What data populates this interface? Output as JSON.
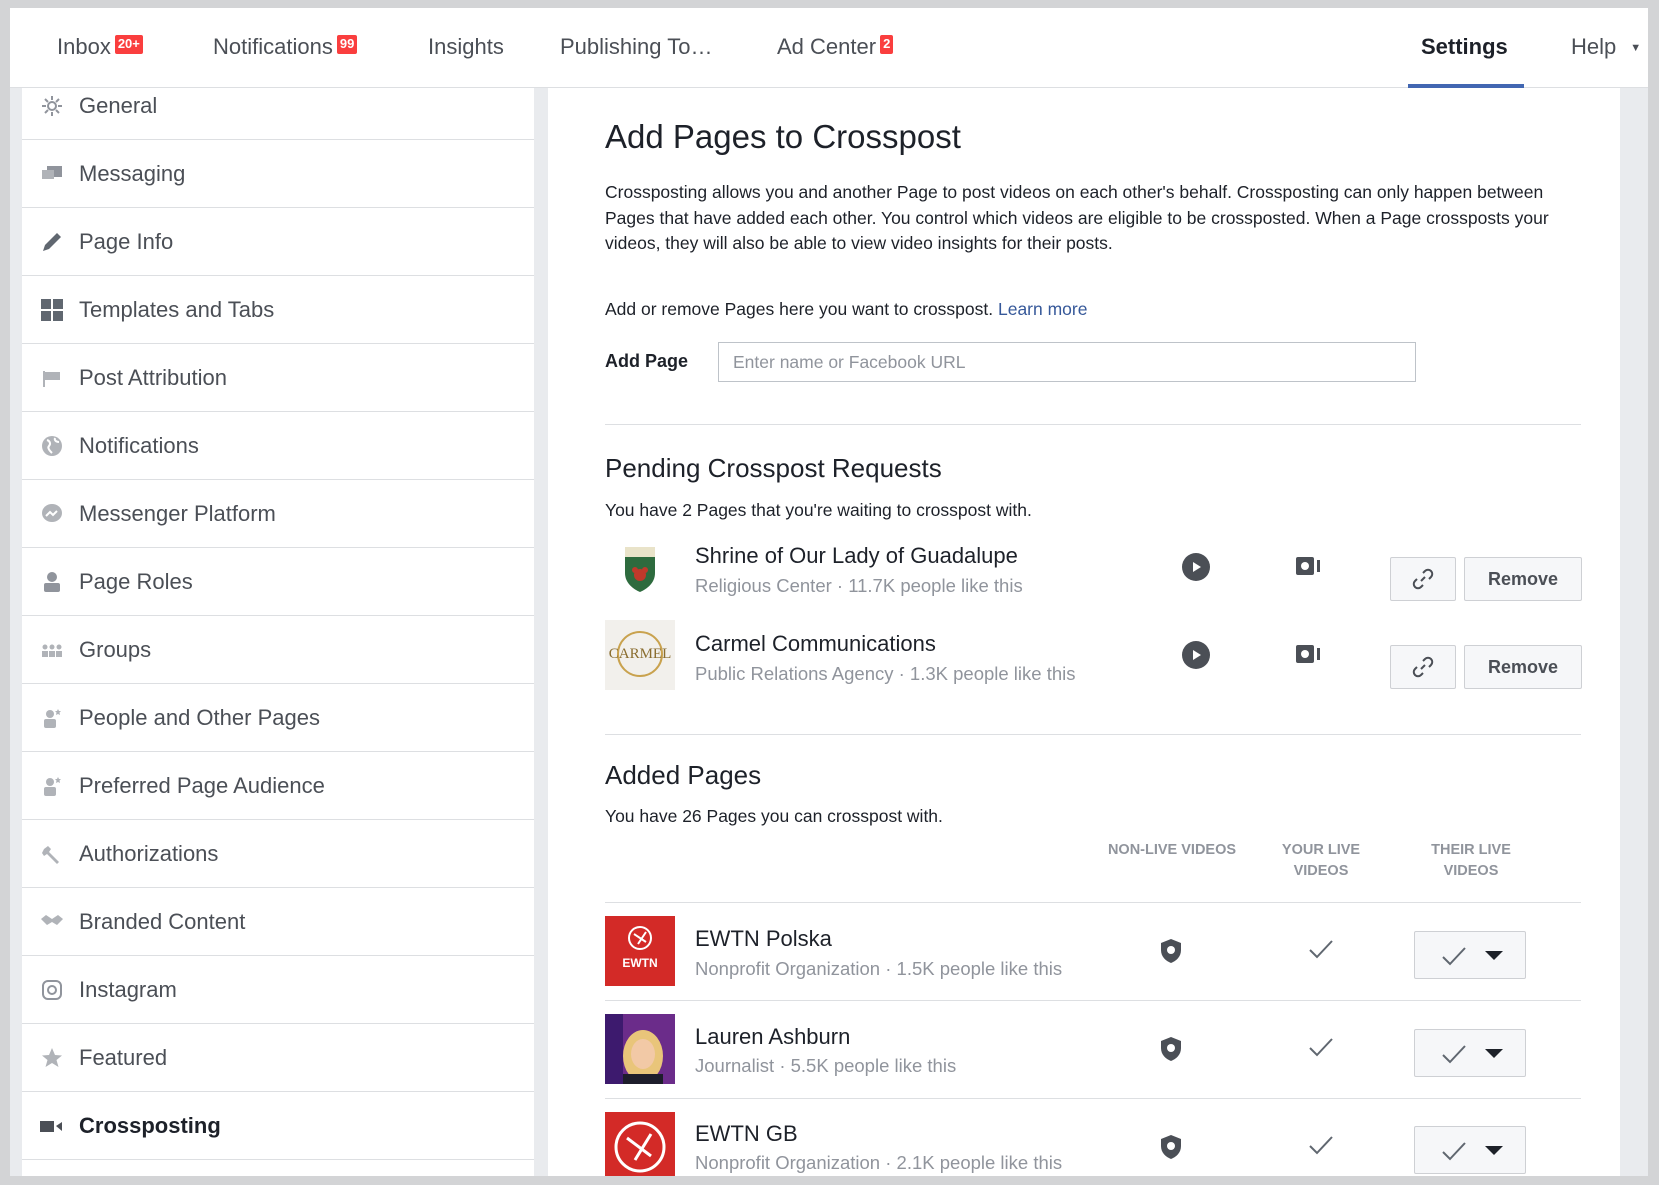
{
  "topnav": {
    "inbox": {
      "label": "Inbox",
      "badge": "20+"
    },
    "notifications": {
      "label": "Notifications",
      "badge": "99"
    },
    "insights": {
      "label": "Insights"
    },
    "publishing": {
      "label": "Publishing To…"
    },
    "adcenter": {
      "label": "Ad Center",
      "badge": "2"
    },
    "settings": {
      "label": "Settings"
    },
    "help": {
      "label": "Help"
    }
  },
  "sidebar": {
    "items": [
      {
        "label": "General",
        "icon": "gear-icon"
      },
      {
        "label": "Messaging",
        "icon": "chat-icon"
      },
      {
        "label": "Page Info",
        "icon": "pencil-icon"
      },
      {
        "label": "Templates and Tabs",
        "icon": "grid-icon"
      },
      {
        "label": "Post Attribution",
        "icon": "flag-icon"
      },
      {
        "label": "Notifications",
        "icon": "globe-icon"
      },
      {
        "label": "Messenger Platform",
        "icon": "messenger-icon"
      },
      {
        "label": "Page Roles",
        "icon": "person-icon"
      },
      {
        "label": "Groups",
        "icon": "groups-icon"
      },
      {
        "label": "People and Other Pages",
        "icon": "person-star-icon"
      },
      {
        "label": "Preferred Page Audience",
        "icon": "person-star-icon"
      },
      {
        "label": "Authorizations",
        "icon": "wrench-icon"
      },
      {
        "label": "Branded Content",
        "icon": "handshake-icon"
      },
      {
        "label": "Instagram",
        "icon": "instagram-icon"
      },
      {
        "label": "Featured",
        "icon": "star-icon"
      },
      {
        "label": "Crossposting",
        "icon": "video-camera-icon"
      }
    ],
    "active": "Crossposting"
  },
  "main": {
    "title": "Add Pages to Crosspost",
    "description": "Crossposting allows you and another Page to post videos on each other's behalf. Crossposting can only happen between Pages that have added each other. You control which videos are eligible to be crossposted. When a Page crossposts your videos, they will also be able to view video insights for their posts.",
    "addremove_text": "Add or remove Pages here you want to crosspost. ",
    "learn_more": "Learn more",
    "add_page_label": "Add Page",
    "add_page_placeholder": "Enter name or Facebook URL",
    "pending": {
      "title": "Pending Crosspost Requests",
      "subtitle": "You have 2 Pages that you're waiting to crosspost with.",
      "remove_label": "Remove",
      "pages": [
        {
          "name": "Shrine of Our Lady of Guadalupe",
          "meta": "Religious Center · 11.7K people like this"
        },
        {
          "name": "Carmel Communications",
          "meta": "Public Relations Agency · 1.3K people like this",
          "logo_text": "CARMEL"
        }
      ]
    },
    "added": {
      "title": "Added Pages",
      "subtitle": "You have 26 Pages you can crosspost with.",
      "columns": [
        "NON-LIVE VIDEOS",
        "YOUR LIVE VIDEOS",
        "THEIR LIVE VIDEOS"
      ],
      "pages": [
        {
          "name": "EWTN Polska",
          "meta": "Nonprofit Organization · 1.5K people like this",
          "logo_text": "EWTN"
        },
        {
          "name": "Lauren Ashburn",
          "meta": "Journalist · 5.5K people like this"
        },
        {
          "name": "EWTN GB",
          "meta": "Nonprofit Organization · 2.1K people like this"
        }
      ]
    }
  },
  "colors": {
    "accent": "#4267b2",
    "badge": "#fa3e3e",
    "link": "#365899",
    "ewtn_red": "#d32a27"
  }
}
